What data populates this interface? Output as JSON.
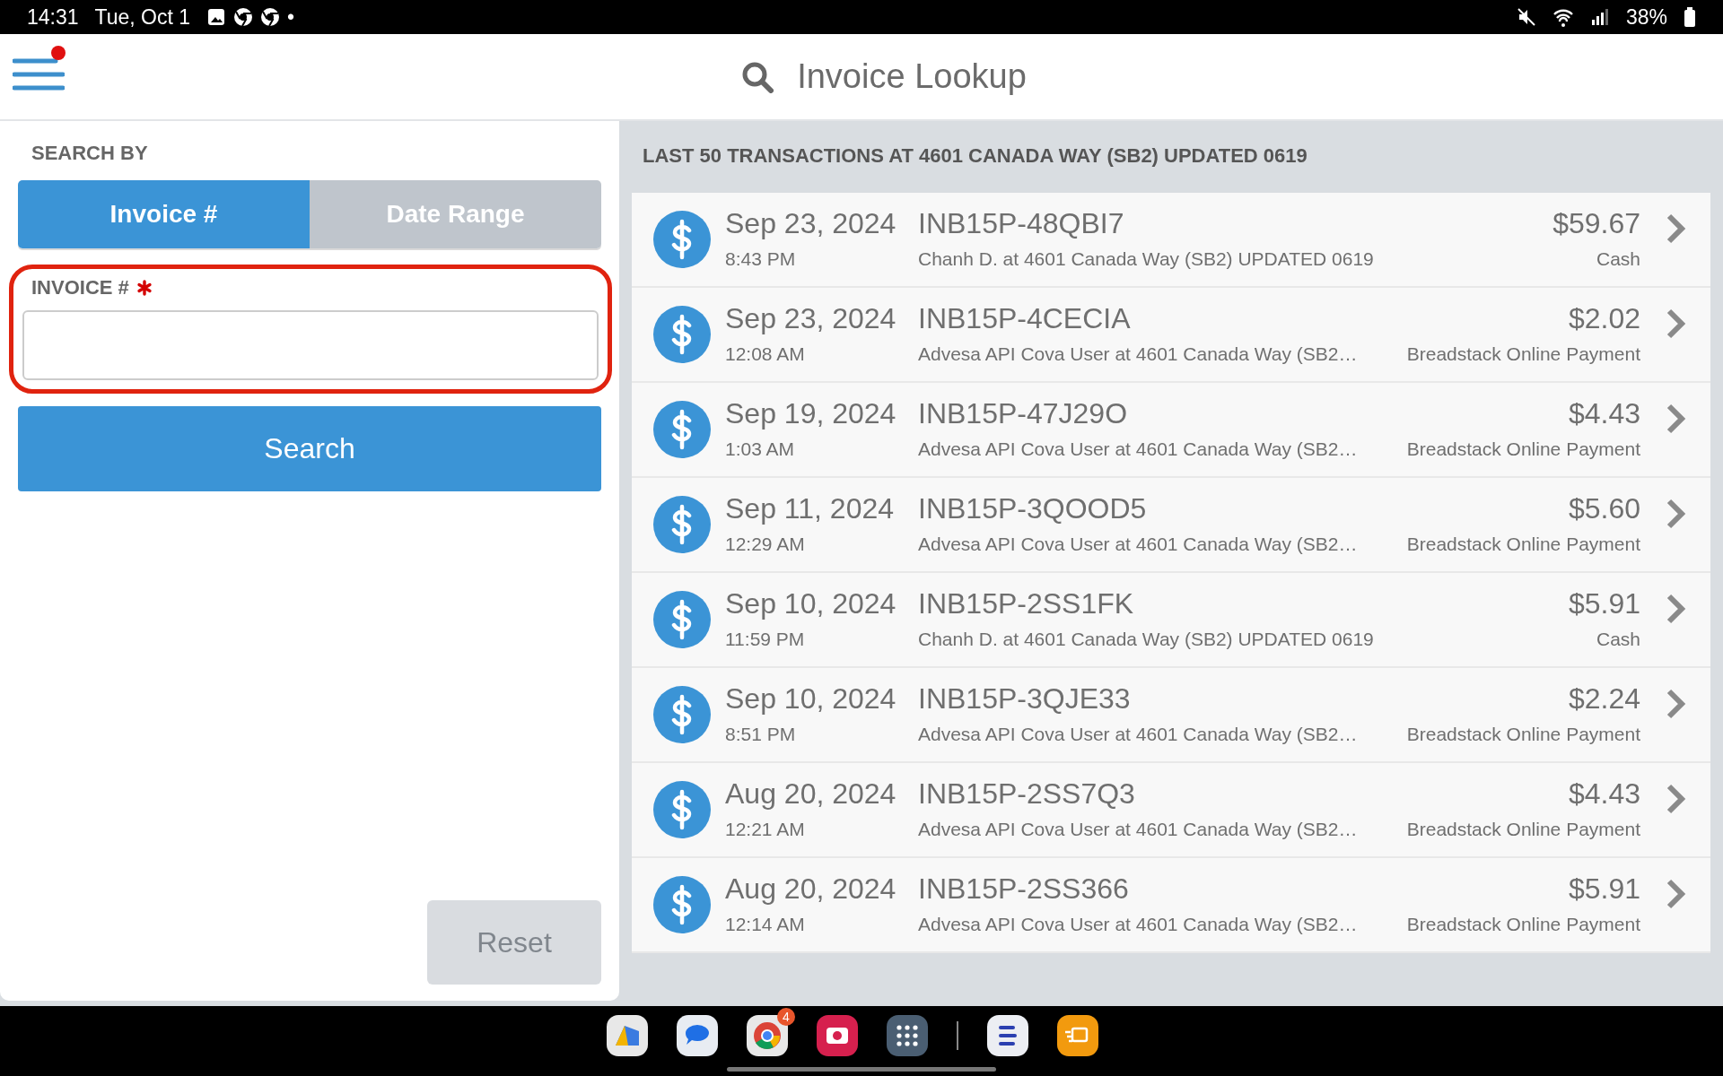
{
  "status_bar": {
    "time": "14:31",
    "date": "Tue, Oct 1",
    "dot": "•",
    "battery": "38%"
  },
  "header": {
    "title": "Invoice Lookup",
    "menu_badge": true
  },
  "search_panel": {
    "heading": "SEARCH BY",
    "tabs": [
      {
        "label": "Invoice #",
        "selected": true
      },
      {
        "label": "Date Range",
        "selected": false
      }
    ],
    "field": {
      "label": "INVOICE #",
      "required": true,
      "highlighted": true
    },
    "search_button": {
      "label": "Search"
    },
    "reset_button": {
      "label": "Reset",
      "disabled": true
    }
  },
  "transactions": {
    "heading": "LAST 50 TRANSACTIONS AT 4601 CANADA WAY (SB2) UPDATED 0619",
    "rows": [
      {
        "date": "Sep 23, 2024",
        "time": "8:43 PM",
        "invoice": "INB15P-48QBI7",
        "description": "Chanh D. at 4601 Canada Way (SB2) UPDATED 0619",
        "amount": "$59.67",
        "payment": "Cash"
      },
      {
        "date": "Sep 23, 2024",
        "time": "12:08 AM",
        "invoice": "INB15P-4CECIA",
        "description": "Advesa API Cova User at 4601 Canada Way (SB2…",
        "amount": "$2.02",
        "payment": "Breadstack Online Payment"
      },
      {
        "date": "Sep 19, 2024",
        "time": "1:03 AM",
        "invoice": "INB15P-47J29O",
        "description": "Advesa API Cova User at 4601 Canada Way (SB2…",
        "amount": "$4.43",
        "payment": "Breadstack Online Payment"
      },
      {
        "date": "Sep 11, 2024",
        "time": "12:29 AM",
        "invoice": "INB15P-3QOOD5",
        "description": "Advesa API Cova User at 4601 Canada Way (SB2…",
        "amount": "$5.60",
        "payment": "Breadstack Online Payment"
      },
      {
        "date": "Sep 10, 2024",
        "time": "11:59 PM",
        "invoice": "INB15P-2SS1FK",
        "description": "Chanh D. at 4601 Canada Way (SB2) UPDATED 0619",
        "amount": "$5.91",
        "payment": "Cash"
      },
      {
        "date": "Sep 10, 2024",
        "time": "8:51 PM",
        "invoice": "INB15P-3QJE33",
        "description": "Advesa API Cova User at 4601 Canada Way (SB2…",
        "amount": "$2.24",
        "payment": "Breadstack Online Payment"
      },
      {
        "date": "Aug 20, 2024",
        "time": "12:21 AM",
        "invoice": "INB15P-2SS7Q3",
        "description": "Advesa API Cova User at 4601 Canada Way (SB2…",
        "amount": "$4.43",
        "payment": "Breadstack Online Payment"
      },
      {
        "date": "Aug 20, 2024",
        "time": "12:14 AM",
        "invoice": "INB15P-2SS366",
        "description": "Advesa API Cova User at 4601 Canada Way (SB2…",
        "amount": "$5.91",
        "payment": "Breadstack Online Payment"
      }
    ]
  },
  "taskbar": {
    "apps": [
      {
        "kind": "gallery"
      },
      {
        "kind": "messages"
      },
      {
        "kind": "browser",
        "badge": "4"
      },
      {
        "kind": "camera"
      },
      {
        "kind": "apps"
      },
      {
        "kind": "divider"
      },
      {
        "kind": "stack"
      },
      {
        "kind": "delivery"
      }
    ]
  }
}
